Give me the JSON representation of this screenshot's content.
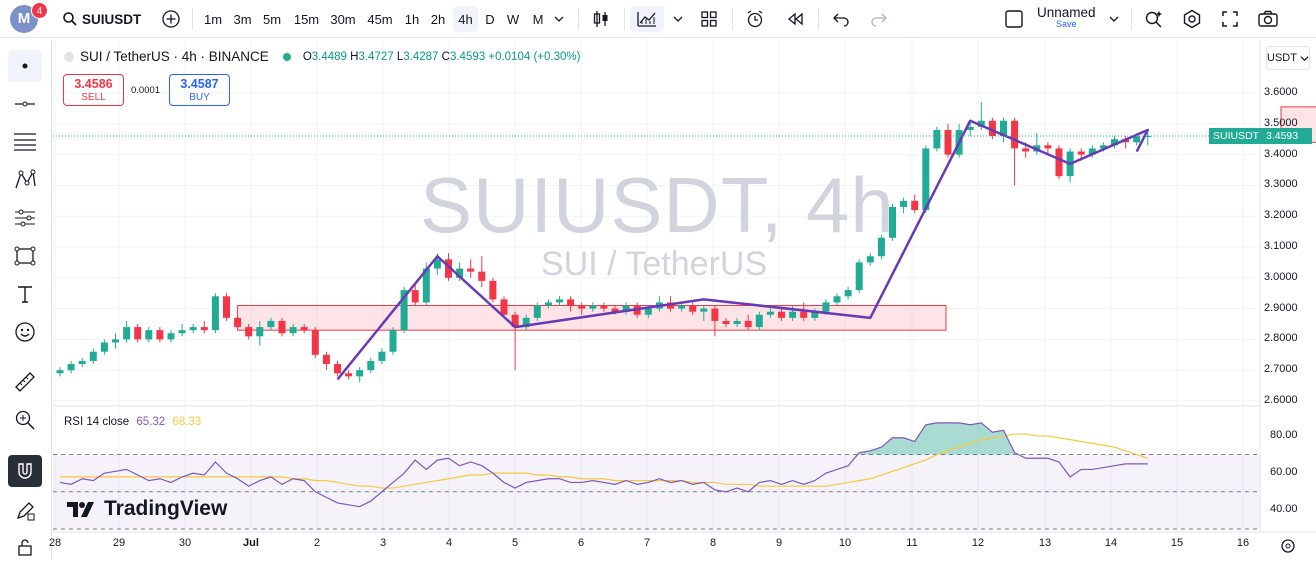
{
  "header": {
    "avatar_letter": "M",
    "notification_count": "4",
    "symbol": "SUIUSDT",
    "intervals": [
      "1m",
      "3m",
      "5m",
      "15m",
      "30m",
      "45m",
      "1h",
      "2h",
      "4h",
      "D",
      "W",
      "M"
    ],
    "active_interval": "4h",
    "layout_name": "Unnamed",
    "save_label": "Save"
  },
  "legend": {
    "title": "SUI / TetherUS · 4h · BINANCE",
    "o_label": "O",
    "o_value": "3.4489",
    "h_label": "H",
    "h_value": "3.4727",
    "l_label": "L",
    "l_value": "3.4287",
    "c_label": "C",
    "c_value": "3.4593",
    "change": "+0.0104 (+0.30%)"
  },
  "trade": {
    "sell_price": "3.4586",
    "sell_label": "SELL",
    "spread": "0.0001",
    "buy_price": "3.4587",
    "buy_label": "BUY"
  },
  "watermark": {
    "line1": "SUIUSDT, 4h",
    "line2": "SUI / TetherUS"
  },
  "price_axis": {
    "currency": "USDT",
    "labels": [
      "3.6000",
      "3.5000",
      "3.4000",
      "3.3000",
      "3.2000",
      "3.1000",
      "3.0000",
      "2.9000",
      "2.8000",
      "2.7000",
      "2.6000"
    ],
    "symbol_tag": "SUIUSDT",
    "current_price": "3.4593"
  },
  "rsi": {
    "label": "RSI 14 close",
    "value": "65.32",
    "ma_value": "68.33",
    "labels": [
      "80.00",
      "60.00",
      "40.00"
    ]
  },
  "time_axis": {
    "labels": [
      "28",
      "29",
      "30",
      "Jul",
      "2",
      "3",
      "4",
      "5",
      "6",
      "7",
      "8",
      "9",
      "10",
      "11",
      "12",
      "13",
      "14",
      "15",
      "16"
    ]
  },
  "branding": {
    "logo_text": "TradingView"
  },
  "colors": {
    "up": "#22ab94",
    "down": "#f23645",
    "pattern": "#673ab7",
    "rsi": "#7e57c2",
    "rsi_ma": "#f7c83c",
    "accent": "#2962ff"
  },
  "chart_data": {
    "type": "candlestick",
    "ylim": [
      2.6,
      3.6
    ],
    "candles": [
      [
        2.69,
        2.7,
        2.68,
        2.71
      ],
      [
        2.7,
        2.72,
        2.69,
        2.73
      ],
      [
        2.72,
        2.73,
        2.71,
        2.74
      ],
      [
        2.73,
        2.76,
        2.72,
        2.77
      ],
      [
        2.76,
        2.79,
        2.75,
        2.8
      ],
      [
        2.79,
        2.8,
        2.77,
        2.82
      ],
      [
        2.8,
        2.84,
        2.79,
        2.86
      ],
      [
        2.84,
        2.8,
        2.79,
        2.85
      ],
      [
        2.8,
        2.83,
        2.79,
        2.84
      ],
      [
        2.83,
        2.8,
        2.79,
        2.84
      ],
      [
        2.8,
        2.82,
        2.79,
        2.83
      ],
      [
        2.82,
        2.83,
        2.81,
        2.85
      ],
      [
        2.83,
        2.84,
        2.82,
        2.85
      ],
      [
        2.84,
        2.83,
        2.82,
        2.86
      ],
      [
        2.83,
        2.94,
        2.82,
        2.95
      ],
      [
        2.94,
        2.87,
        2.86,
        2.95
      ],
      [
        2.87,
        2.84,
        2.83,
        2.88
      ],
      [
        2.84,
        2.81,
        2.8,
        2.85
      ],
      [
        2.81,
        2.84,
        2.78,
        2.86
      ],
      [
        2.84,
        2.86,
        2.83,
        2.87
      ],
      [
        2.86,
        2.82,
        2.81,
        2.87
      ],
      [
        2.82,
        2.84,
        2.81,
        2.85
      ],
      [
        2.84,
        2.83,
        2.82,
        2.85
      ],
      [
        2.83,
        2.75,
        2.74,
        2.84
      ],
      [
        2.75,
        2.72,
        2.7,
        2.76
      ],
      [
        2.72,
        2.69,
        2.68,
        2.73
      ],
      [
        2.69,
        2.68,
        2.67,
        2.7
      ],
      [
        2.68,
        2.7,
        2.66,
        2.71
      ],
      [
        2.7,
        2.73,
        2.69,
        2.74
      ],
      [
        2.73,
        2.76,
        2.72,
        2.77
      ],
      [
        2.76,
        2.83,
        2.75,
        2.84
      ],
      [
        2.83,
        2.96,
        2.82,
        2.97
      ],
      [
        2.96,
        2.92,
        2.91,
        2.98
      ],
      [
        2.92,
        3.03,
        2.91,
        3.05
      ],
      [
        3.03,
        3.06,
        3.01,
        3.08
      ],
      [
        3.06,
        3.0,
        2.99,
        3.08
      ],
      [
        3.0,
        3.03,
        2.99,
        3.05
      ],
      [
        3.03,
        3.02,
        3.0,
        3.06
      ],
      [
        3.02,
        2.99,
        2.97,
        3.07
      ],
      [
        2.99,
        2.93,
        2.92,
        3.0
      ],
      [
        2.93,
        2.88,
        2.87,
        2.94
      ],
      [
        2.88,
        2.84,
        2.7,
        2.89
      ],
      [
        2.84,
        2.87,
        2.83,
        2.88
      ],
      [
        2.87,
        2.91,
        2.86,
        2.92
      ],
      [
        2.91,
        2.92,
        2.9,
        2.93
      ],
      [
        2.92,
        2.93,
        2.91,
        2.94
      ],
      [
        2.93,
        2.91,
        2.89,
        2.94
      ],
      [
        2.91,
        2.9,
        2.88,
        2.92
      ],
      [
        2.9,
        2.91,
        2.89,
        2.92
      ],
      [
        2.91,
        2.9,
        2.89,
        2.92
      ],
      [
        2.9,
        2.89,
        2.88,
        2.91
      ],
      [
        2.89,
        2.91,
        2.88,
        2.92
      ],
      [
        2.91,
        2.88,
        2.87,
        2.92
      ],
      [
        2.88,
        2.9,
        2.87,
        2.91
      ],
      [
        2.9,
        2.92,
        2.89,
        2.94
      ],
      [
        2.92,
        2.9,
        2.89,
        2.94
      ],
      [
        2.9,
        2.91,
        2.89,
        2.92
      ],
      [
        2.91,
        2.89,
        2.88,
        2.92
      ],
      [
        2.89,
        2.9,
        2.86,
        2.91
      ],
      [
        2.9,
        2.86,
        2.81,
        2.91
      ],
      [
        2.86,
        2.85,
        2.84,
        2.87
      ],
      [
        2.85,
        2.86,
        2.84,
        2.87
      ],
      [
        2.86,
        2.84,
        2.83,
        2.88
      ],
      [
        2.84,
        2.88,
        2.83,
        2.89
      ],
      [
        2.88,
        2.89,
        2.87,
        2.9
      ],
      [
        2.89,
        2.87,
        2.86,
        2.9
      ],
      [
        2.87,
        2.89,
        2.86,
        2.91
      ],
      [
        2.89,
        2.87,
        2.86,
        2.92
      ],
      [
        2.87,
        2.89,
        2.86,
        2.9
      ],
      [
        2.89,
        2.92,
        2.88,
        2.93
      ],
      [
        2.92,
        2.94,
        2.91,
        2.95
      ],
      [
        2.94,
        2.96,
        2.93,
        2.97
      ],
      [
        2.96,
        3.05,
        2.95,
        3.06
      ],
      [
        3.05,
        3.07,
        3.04,
        3.08
      ],
      [
        3.07,
        3.13,
        3.06,
        3.14
      ],
      [
        3.13,
        3.23,
        3.12,
        3.24
      ],
      [
        3.23,
        3.25,
        3.21,
        3.26
      ],
      [
        3.25,
        3.22,
        3.21,
        3.27
      ],
      [
        3.22,
        3.42,
        3.21,
        3.43
      ],
      [
        3.42,
        3.48,
        3.41,
        3.49
      ],
      [
        3.48,
        3.4,
        3.39,
        3.5
      ],
      [
        3.4,
        3.48,
        3.39,
        3.5
      ],
      [
        3.48,
        3.49,
        3.46,
        3.51
      ],
      [
        3.49,
        3.51,
        3.48,
        3.57
      ],
      [
        3.51,
        3.46,
        3.45,
        3.52
      ],
      [
        3.46,
        3.51,
        3.44,
        3.52
      ],
      [
        3.51,
        3.42,
        3.3,
        3.52
      ],
      [
        3.42,
        3.41,
        3.39,
        3.44
      ],
      [
        3.41,
        3.43,
        3.4,
        3.47
      ],
      [
        3.43,
        3.42,
        3.4,
        3.44
      ],
      [
        3.42,
        3.33,
        3.32,
        3.43
      ],
      [
        3.33,
        3.41,
        3.31,
        3.42
      ],
      [
        3.41,
        3.4,
        3.38,
        3.42
      ],
      [
        3.4,
        3.42,
        3.39,
        3.43
      ],
      [
        3.42,
        3.43,
        3.41,
        3.44
      ],
      [
        3.43,
        3.45,
        3.42,
        3.46
      ],
      [
        3.45,
        3.44,
        3.42,
        3.46
      ],
      [
        3.44,
        3.46,
        3.43,
        3.47
      ],
      [
        3.46,
        3.46,
        3.43,
        3.47
      ]
    ],
    "rsi_ylim": [
      30,
      95
    ],
    "rsi_values": [
      55,
      54,
      57,
      56,
      60,
      61,
      62,
      59,
      56,
      57,
      55,
      58,
      60,
      59,
      66,
      60,
      57,
      53,
      56,
      58,
      54,
      57,
      56,
      50,
      47,
      44,
      43,
      42,
      45,
      50,
      55,
      60,
      67,
      62,
      67,
      68,
      64,
      66,
      64,
      60,
      55,
      52,
      55,
      56,
      57,
      57,
      55,
      55,
      56,
      55,
      54,
      56,
      54,
      55,
      57,
      55,
      56,
      54,
      55,
      51,
      50,
      52,
      50,
      55,
      56,
      54,
      56,
      54,
      56,
      60,
      62,
      64,
      71,
      72,
      74,
      79,
      79,
      77,
      86,
      87,
      87,
      87,
      86,
      87,
      82,
      83,
      71,
      68,
      68,
      68,
      66,
      58,
      62,
      62,
      63,
      64,
      65,
      65,
      65
    ],
    "rsi_ma_values": [
      58,
      58,
      58,
      58,
      58,
      58,
      58,
      58,
      58,
      58,
      58,
      58,
      58,
      58,
      58,
      58,
      58,
      58,
      58,
      58,
      58,
      57,
      57,
      56,
      56,
      55,
      54,
      53,
      53,
      52,
      52,
      53,
      54,
      55,
      56,
      57,
      58,
      59,
      59,
      60,
      60,
      60,
      60,
      59,
      59,
      58,
      58,
      57,
      57,
      57,
      56,
      56,
      56,
      56,
      56,
      56,
      56,
      55,
      55,
      55,
      54,
      54,
      54,
      53,
      53,
      53,
      53,
      53,
      53,
      53,
      54,
      55,
      56,
      57,
      59,
      61,
      63,
      65,
      67,
      70,
      72,
      74,
      76,
      78,
      79,
      80,
      81,
      81,
      80,
      80,
      79,
      78,
      77,
      76,
      75,
      74,
      72,
      70,
      68
    ],
    "zones": [
      {
        "from": 2.83,
        "to": 2.91,
        "start_index": 16,
        "end_index": 108
      },
      {
        "from": 3.44,
        "to": 3.555,
        "start_index": 110,
        "end_index": 160
      }
    ],
    "pattern": [
      [
        25,
        2.67
      ],
      [
        34,
        3.07
      ],
      [
        41,
        2.84
      ],
      [
        58,
        2.93
      ],
      [
        73,
        2.87
      ],
      [
        82,
        3.51
      ],
      [
        91,
        3.37
      ],
      [
        98,
        3.48
      ],
      [
        97,
        3.41
      ]
    ]
  }
}
